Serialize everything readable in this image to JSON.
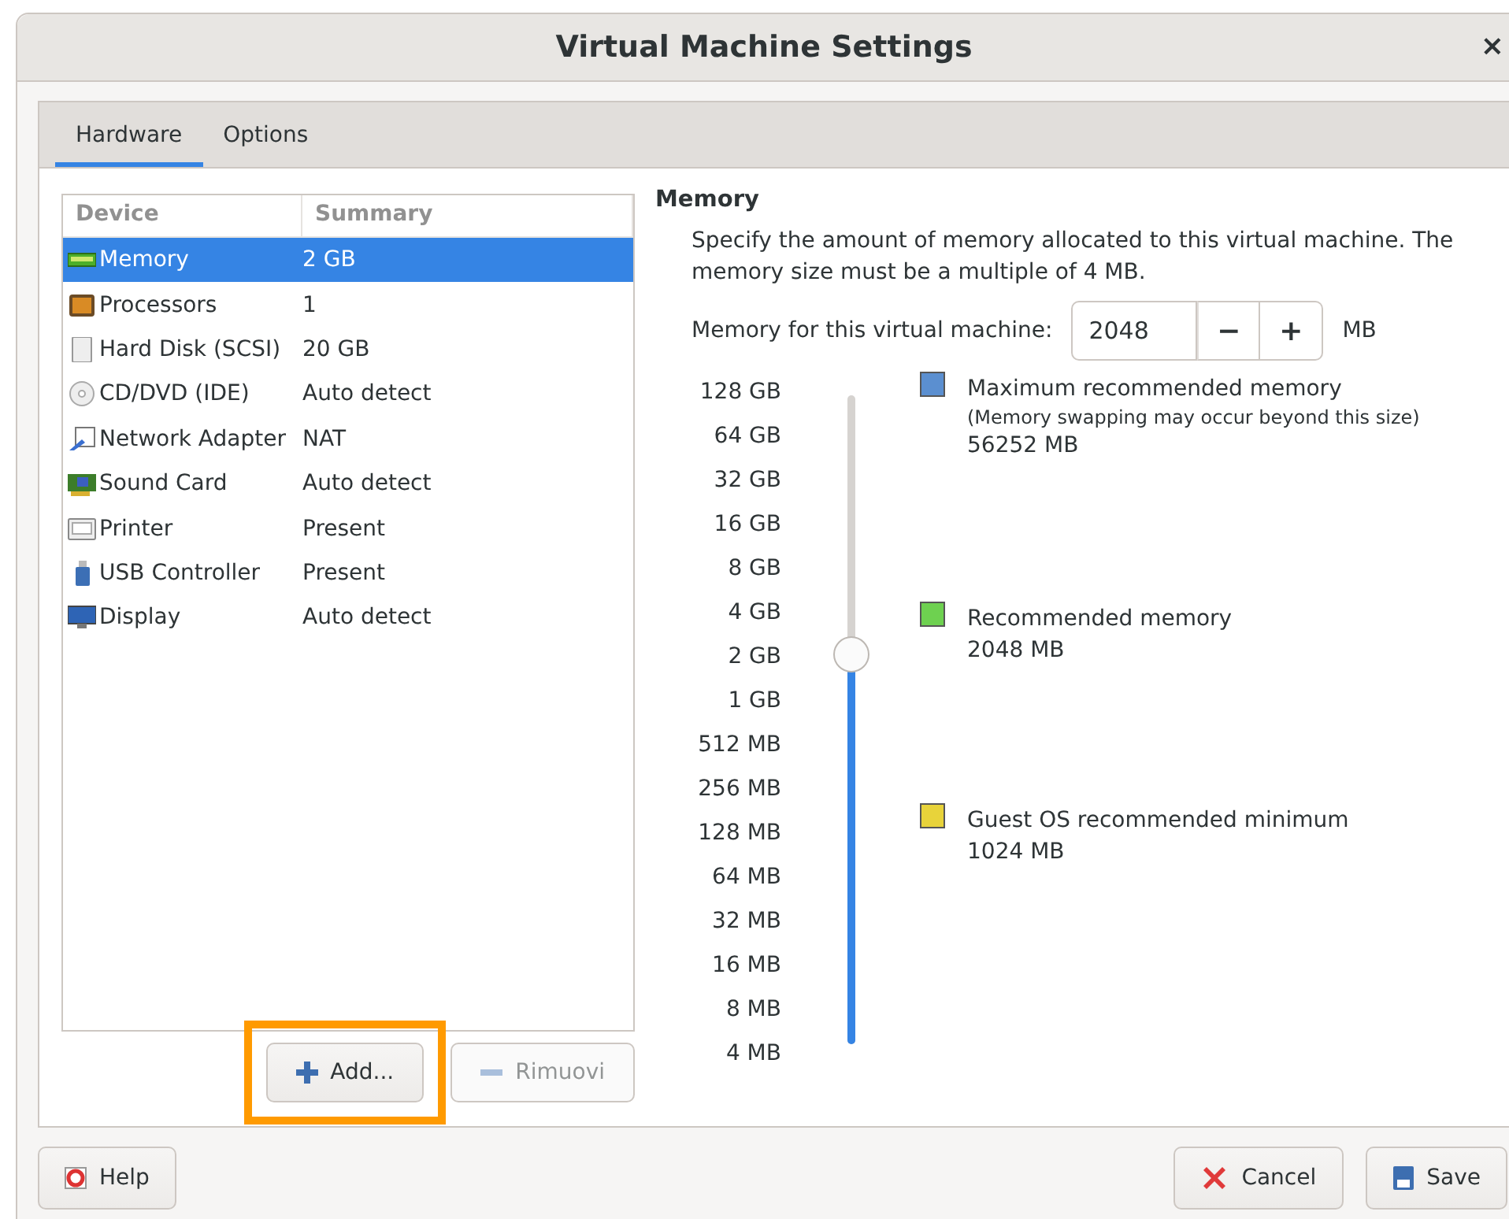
{
  "window": {
    "title": "Virtual Machine Settings",
    "close": "×"
  },
  "tabs": [
    {
      "label": "Hardware",
      "selected": true
    },
    {
      "label": "Options",
      "selected": false
    }
  ],
  "devices": {
    "columns": [
      "Device",
      "Summary"
    ],
    "rows": [
      {
        "kind": "memory",
        "name": "Memory",
        "summary": "2 GB",
        "selected": true
      },
      {
        "kind": "cpu",
        "name": "Processors",
        "summary": "1",
        "selected": false
      },
      {
        "kind": "disk",
        "name": "Hard Disk (SCSI)",
        "summary": "20 GB",
        "selected": false
      },
      {
        "kind": "cd",
        "name": "CD/DVD (IDE)",
        "summary": "Auto detect",
        "selected": false
      },
      {
        "kind": "network",
        "name": "Network Adapter",
        "summary": "NAT",
        "selected": false
      },
      {
        "kind": "sound",
        "name": "Sound Card",
        "summary": "Auto detect",
        "selected": false
      },
      {
        "kind": "printer",
        "name": "Printer",
        "summary": "Present",
        "selected": false
      },
      {
        "kind": "usb",
        "name": "USB Controller",
        "summary": "Present",
        "selected": false
      },
      {
        "kind": "display",
        "name": "Display",
        "summary": "Auto detect",
        "selected": false
      }
    ]
  },
  "add_button": {
    "label": "Add...",
    "highlighted": true,
    "disabled": false
  },
  "remove_button": {
    "label": "Rimuovi",
    "disabled": true
  },
  "memory": {
    "heading": "Memory",
    "description": "Specify the amount of memory allocated to this virtual machine. The memory size must be a multiple of 4 MB.",
    "field_label": "Memory for this virtual machine:",
    "value": "2048",
    "decrement": "−",
    "increment": "+",
    "unit": "MB",
    "scale": [
      "128 GB",
      "64 GB",
      "32 GB",
      "16 GB",
      "8 GB",
      "4 GB",
      "2 GB",
      "1 GB",
      "512 MB",
      "256 MB",
      "128 MB",
      "64 MB",
      "32 MB",
      "16 MB",
      "8 MB",
      "4 MB"
    ],
    "level": 0.6,
    "legend": [
      {
        "title": "Maximum recommended memory",
        "note": "(Memory swapping may occur beyond this size)",
        "value": "56252 MB",
        "color": "#5b8fd0"
      },
      {
        "title": "Recommended memory",
        "value": "2048 MB",
        "color": "#6ed150"
      },
      {
        "title": "Guest OS recommended minimum",
        "value": "1024 MB",
        "color": "#e8d33a"
      }
    ]
  },
  "footer": {
    "help": "Help",
    "cancel": "Cancel",
    "save": "Save"
  }
}
